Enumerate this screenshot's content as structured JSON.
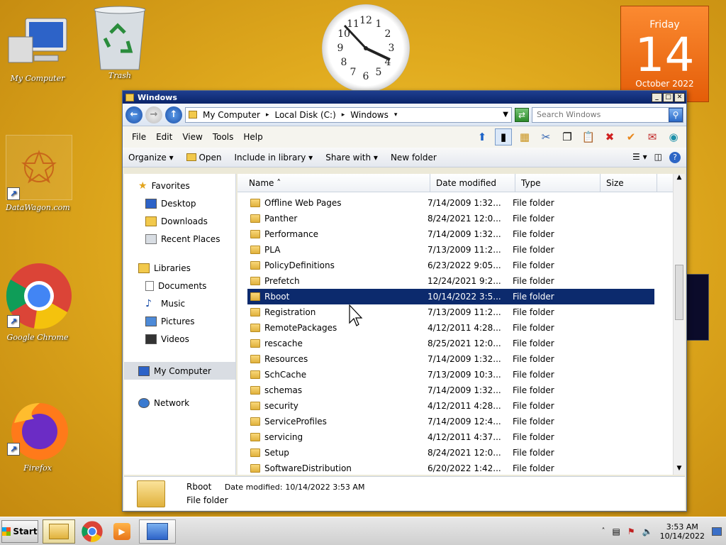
{
  "desktop": {
    "icons": [
      {
        "label": "My Computer"
      },
      {
        "label": "Trash"
      },
      {
        "label": "DataWagon.com"
      },
      {
        "label": "Google Chrome"
      },
      {
        "label": "Firefox"
      }
    ],
    "calendar": {
      "day": "Friday",
      "date": "14",
      "month": "October 2022"
    },
    "clock_widget": {
      "numerals": [
        "12",
        "1",
        "2",
        "3",
        "4",
        "5",
        "6",
        "7",
        "8",
        "9",
        "10",
        "11"
      ]
    }
  },
  "window": {
    "title": "Windows",
    "address": {
      "parts": [
        "My Computer",
        "Local Disk (C:)",
        "Windows"
      ]
    },
    "search": {
      "placeholder": "Search Windows"
    },
    "menu": [
      "File",
      "Edit",
      "View",
      "Tools",
      "Help"
    ],
    "commands": {
      "organize": "Organize",
      "open": "Open",
      "include": "Include in library",
      "share": "Share with",
      "newfolder": "New folder"
    },
    "nav": {
      "favorites": "Favorites",
      "desktop": "Desktop",
      "downloads": "Downloads",
      "recent": "Recent Places",
      "libraries": "Libraries",
      "documents": "Documents",
      "music": "Music",
      "pictures": "Pictures",
      "videos": "Videos",
      "mycomputer": "My Computer",
      "network": "Network"
    },
    "columns": {
      "name": "Name",
      "date": "Date modified",
      "type": "Type",
      "size": "Size"
    },
    "rows": [
      {
        "name": "Offline Web Pages",
        "date": "7/14/2009 1:32...",
        "type": "File folder"
      },
      {
        "name": "Panther",
        "date": "8/24/2021 12:0...",
        "type": "File folder"
      },
      {
        "name": "Performance",
        "date": "7/14/2009 1:32...",
        "type": "File folder"
      },
      {
        "name": "PLA",
        "date": "7/13/2009 11:2...",
        "type": "File folder"
      },
      {
        "name": "PolicyDefinitions",
        "date": "6/23/2022 9:05...",
        "type": "File folder"
      },
      {
        "name": "Prefetch",
        "date": "12/24/2021 9:2...",
        "type": "File folder"
      },
      {
        "name": "Rboot",
        "date": "10/14/2022 3:5...",
        "type": "File folder",
        "selected": true
      },
      {
        "name": "Registration",
        "date": "7/13/2009 11:2...",
        "type": "File folder"
      },
      {
        "name": "RemotePackages",
        "date": "4/12/2011 4:28...",
        "type": "File folder"
      },
      {
        "name": "rescache",
        "date": "8/25/2021 12:0...",
        "type": "File folder"
      },
      {
        "name": "Resources",
        "date": "7/14/2009 1:32...",
        "type": "File folder"
      },
      {
        "name": "SchCache",
        "date": "7/13/2009 10:3...",
        "type": "File folder"
      },
      {
        "name": "schemas",
        "date": "7/14/2009 1:32...",
        "type": "File folder"
      },
      {
        "name": "security",
        "date": "4/12/2011 4:28...",
        "type": "File folder"
      },
      {
        "name": "ServiceProfiles",
        "date": "7/14/2009 12:4...",
        "type": "File folder"
      },
      {
        "name": "servicing",
        "date": "4/12/2011 4:37...",
        "type": "File folder"
      },
      {
        "name": "Setup",
        "date": "8/24/2021 12:0...",
        "type": "File folder"
      },
      {
        "name": "SoftwareDistribution",
        "date": "6/20/2022 1:42...",
        "type": "File folder"
      }
    ],
    "details": {
      "name": "Rboot",
      "modified_label": "Date modified:",
      "modified": "10/14/2022 3:53 AM",
      "type": "File folder"
    }
  },
  "taskbar": {
    "start": "Start",
    "time": "3:53 AM",
    "date": "10/14/2022"
  },
  "colors": {
    "selection": "#0c2a6d",
    "calendar": "#f07a1e",
    "titlebar": "#0a246a"
  }
}
